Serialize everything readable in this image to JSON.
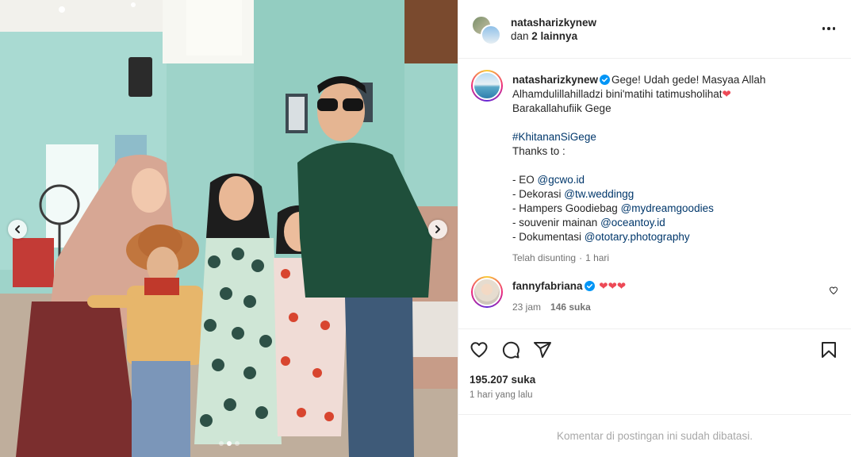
{
  "header": {
    "username": "natasharizkynew",
    "coauthors_prefix": "dan",
    "coauthors_count": "2 lainnya",
    "more_icon": "more-horizontal-icon"
  },
  "caption": {
    "username": "natasharizkynew",
    "line1": "Gege! Udah gede! Masyaa Allah",
    "line2": "Alhamdulillahilladzi bini'matihi tatimusholihat",
    "line3": "Barakallahufiik Gege",
    "hashtag": "#KhitananSiGege",
    "thanks": "Thanks to :",
    "credits": [
      {
        "label": "- EO ",
        "handle": "@gcwo.id"
      },
      {
        "label": "- Dekorasi ",
        "handle": "@tw.weddingg"
      },
      {
        "label": "- Hampers Goodiebag ",
        "handle": "@mydreamgoodies"
      },
      {
        "label": "- souvenir mainan ",
        "handle": "@oceantoy.id"
      },
      {
        "label": "- Dokumentasi ",
        "handle": "@ototary.photography"
      }
    ],
    "edited": "Telah disunting",
    "age": "1 hari"
  },
  "comment": {
    "username": "fannyfabriana",
    "text": "❤❤❤",
    "age": "23 jam",
    "likes": "146 suka"
  },
  "actions": {
    "likes": "195.207 suka",
    "posted": "1 hari yang lalu"
  },
  "footer": {
    "limited": "Komentar di postingan ini sudah dibatasi."
  },
  "media": {
    "slide_count": 3,
    "active_slide": 2
  },
  "colors": {
    "verified": "#0095f6",
    "link": "#00376b",
    "heart": "#ed4956",
    "muted": "#737373"
  }
}
